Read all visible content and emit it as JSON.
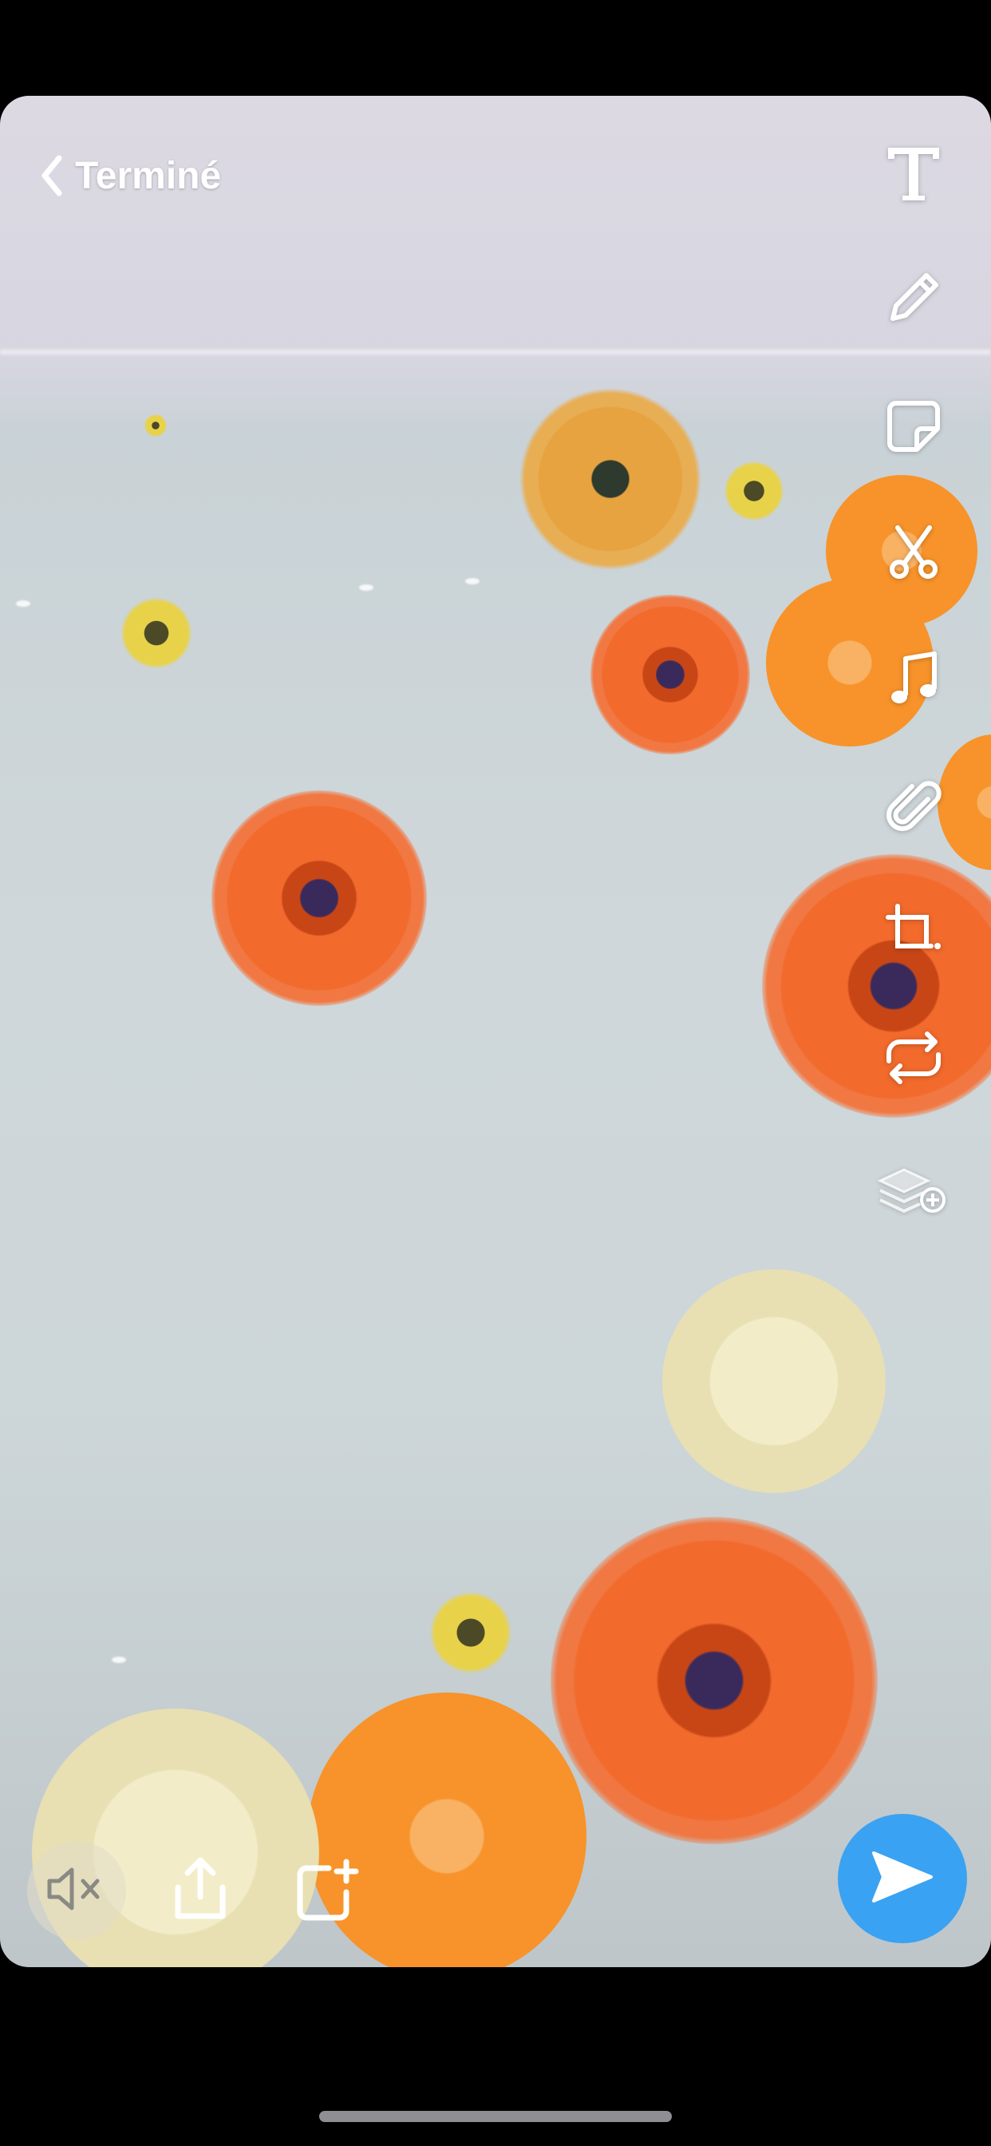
{
  "header": {
    "done_label": "Terminé"
  },
  "toolbar": {
    "items": [
      {
        "name": "text-tool",
        "icon": "text-icon"
      },
      {
        "name": "draw-tool",
        "icon": "pencil-icon"
      },
      {
        "name": "sticker-tool",
        "icon": "sticker-icon"
      },
      {
        "name": "scissors-tool",
        "icon": "scissors-icon"
      },
      {
        "name": "music-tool",
        "icon": "music-note-icon"
      },
      {
        "name": "attachment-tool",
        "icon": "paperclip-icon"
      },
      {
        "name": "crop-tool",
        "icon": "crop-icon"
      },
      {
        "name": "loop-tool",
        "icon": "loop-icon"
      },
      {
        "name": "layers-tool",
        "icon": "layers-add-icon"
      }
    ]
  },
  "bottom_bar": {
    "mute_icon": "speaker-muted-icon",
    "share_icon": "share-icon",
    "add_story_icon": "add-story-icon",
    "send_icon": "send-arrow-icon"
  },
  "colors": {
    "send_button": "#3aa2f3",
    "icon": "#ffffff",
    "background": "#000000"
  }
}
